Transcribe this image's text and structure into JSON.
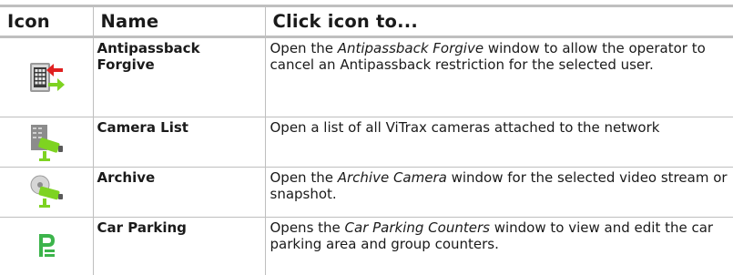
{
  "table": {
    "headers": {
      "icon": "Icon",
      "name": "Name",
      "action": "Click icon to..."
    },
    "rows": [
      {
        "icon": "antipassback-forgive-icon",
        "name": "Antipassback Forgive",
        "desc_before": "Open the ",
        "desc_italic": "Antipassback Forgive",
        "desc_after": " window to allow the operator to cancel an Antipassback restriction for the selected user."
      },
      {
        "icon": "camera-list-icon",
        "name": "Camera List",
        "desc_before": "Open a list of all ViTrax cameras attached to the network",
        "desc_italic": "",
        "desc_after": ""
      },
      {
        "icon": "archive-camera-icon",
        "name": "Archive",
        "desc_before": "Open the ",
        "desc_italic": "Archive Camera",
        "desc_after": " window for the selected video stream or snapshot."
      },
      {
        "icon": "car-parking-icon",
        "name": "Car Parking",
        "desc_before": "Opens the ",
        "desc_italic": "Car Parking Counters",
        "desc_after": " window to view and edit the car parking area and group counters."
      }
    ]
  },
  "colors": {
    "rule": "#bfbfbf",
    "icon_green": "#7ed321",
    "icon_red": "#e02020",
    "parking_green": "#3cb44b"
  }
}
